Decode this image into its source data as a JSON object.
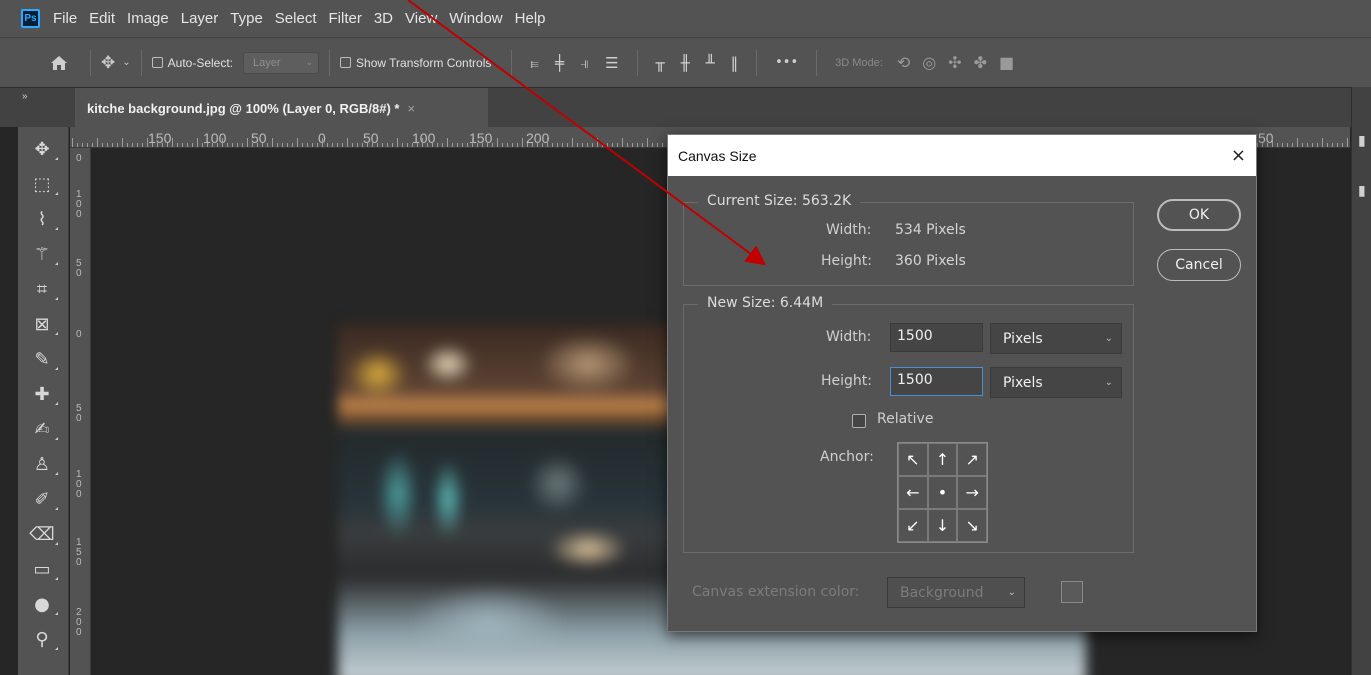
{
  "app": {
    "logo_text": "Ps"
  },
  "menu": [
    "File",
    "Edit",
    "Image",
    "Layer",
    "Type",
    "Select",
    "Filter",
    "3D",
    "View",
    "Window",
    "Help"
  ],
  "options_bar": {
    "auto_select_label": "Auto-Select:",
    "auto_select_target": "Layer",
    "show_transform_label": "Show Transform Controls",
    "mode_3d_label": "3D Mode:"
  },
  "document_tab": {
    "label": "kitche background.jpg @ 100% (Layer 0, RGB/8#) *",
    "close_glyph": "×"
  },
  "ruler_top": [
    "150",
    "100",
    "50",
    "0",
    "50",
    "100",
    "150",
    "200",
    "50"
  ],
  "ruler_left": [
    "0",
    "1\n0\n0",
    "5\n0",
    "0",
    "5\n0",
    "1\n0\n0",
    "1\n5\n0",
    "2\n0\n0"
  ],
  "dialog": {
    "title": "Canvas Size",
    "close_glyph": "×",
    "current_size": {
      "title": "Current Size: 563.2K",
      "width_label": "Width:",
      "width_value": "534 Pixels",
      "height_label": "Height:",
      "height_value": "360 Pixels"
    },
    "new_size": {
      "title": "New Size: 6.44M",
      "width_label": "Width:",
      "width_value": "1500",
      "width_unit": "Pixels",
      "height_label": "Height:",
      "height_value": "1500",
      "height_unit": "Pixels",
      "relative_label": "Relative",
      "relative_checked": false,
      "anchor_label": "Anchor:",
      "anchor_glyphs": [
        "↖",
        "↑",
        "↗",
        "←",
        "•",
        "→",
        "↙",
        "↓",
        "↘"
      ]
    },
    "extension_color_label": "Canvas extension color:",
    "extension_color_value": "Background",
    "ok_label": "OK",
    "cancel_label": "Cancel"
  },
  "colors": {
    "accent_blue": "#31a8ff",
    "annotation_arrow": "#c00000",
    "panel_bg": "#535353",
    "canvas_bg": "#262626"
  }
}
